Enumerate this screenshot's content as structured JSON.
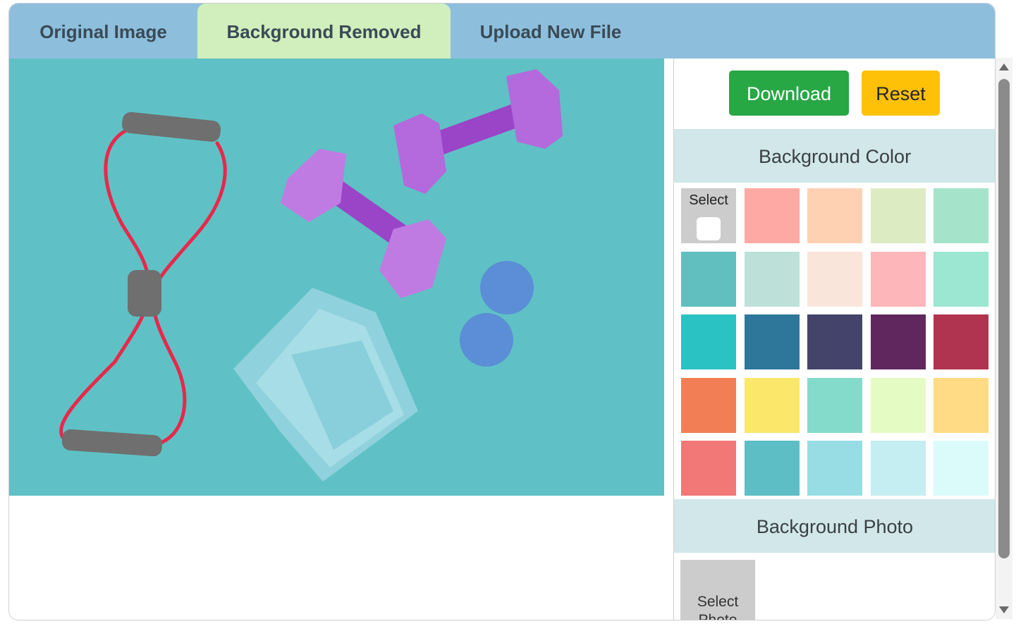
{
  "tabs": [
    {
      "label": "Original Image",
      "active": false
    },
    {
      "label": "Background Removed",
      "active": true
    },
    {
      "label": "Upload New File",
      "active": false
    }
  ],
  "toolbar": {
    "download_label": "Download",
    "reset_label": "Reset"
  },
  "background_color": {
    "heading": "Background Color",
    "select_label": "Select",
    "swatches": [
      "#fea9a3",
      "#ffd1b3",
      "#ddebc3",
      "#a5e4cb",
      "#61bfbf",
      "#bde1d8",
      "#fae5db",
      "#fdb6ba",
      "#9be7d1",
      "#2bc2c4",
      "#2e779b",
      "#44446a",
      "#5f275e",
      "#b0344f",
      "#f27e56",
      "#fbe769",
      "#85dbcb",
      "#e4fcc4",
      "#fedb84",
      "#f27777",
      "#5dbec6",
      "#98dde4",
      "#c4eef1",
      "#dbfbfa"
    ]
  },
  "background_photo": {
    "heading": "Background Photo",
    "select_label": "Select Photo"
  },
  "colors": {
    "tabbar": "#8dbfdd",
    "active_tab": "#d1eebd",
    "canvas": "#5fc1c5",
    "download": "#28a745",
    "reset": "#ffc107",
    "section": "#d1e7e9"
  }
}
